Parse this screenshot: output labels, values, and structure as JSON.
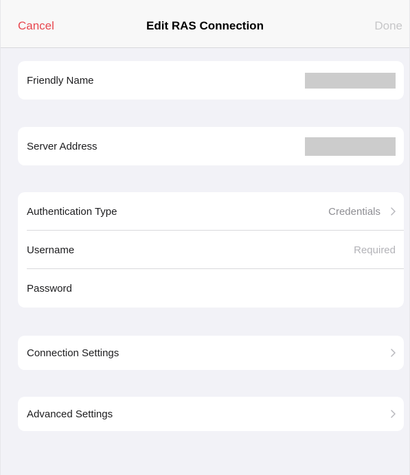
{
  "navbar": {
    "cancel_label": "Cancel",
    "title": "Edit RAS Connection",
    "done_label": "Done"
  },
  "friendly_name": {
    "label": "Friendly Name",
    "value": ""
  },
  "server_address": {
    "label": "Server Address",
    "value": ""
  },
  "auth": {
    "type_label": "Authentication Type",
    "type_value": "Credentials",
    "username_label": "Username",
    "username_placeholder": "Required",
    "password_label": "Password",
    "password_placeholder": ""
  },
  "connection_settings": {
    "label": "Connection Settings"
  },
  "advanced_settings": {
    "label": "Advanced Settings"
  },
  "colors": {
    "accent": "#e8474f",
    "disabled": "#c6c6c8",
    "background": "#f2f2f7"
  },
  "icons": {
    "disclosure": "chevron-right-icon"
  }
}
